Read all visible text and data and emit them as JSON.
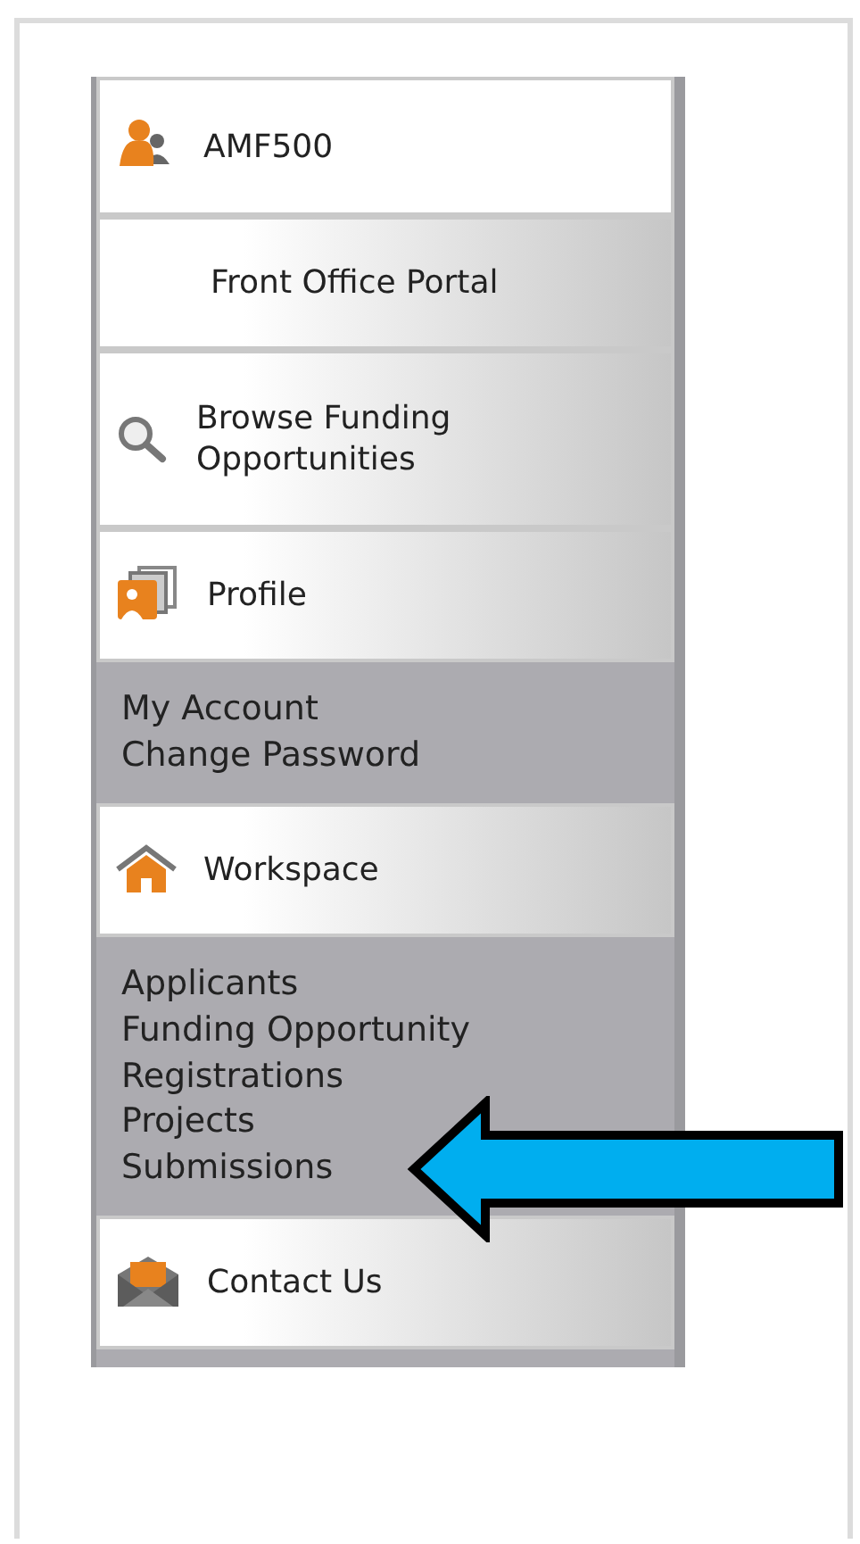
{
  "menu": [
    {
      "kind": "user",
      "label": "AMF500"
    },
    {
      "kind": "plain",
      "label": "Front Office Portal"
    },
    {
      "kind": "search",
      "label": "Browse Funding Opportunities"
    },
    {
      "kind": "profile",
      "label": "Profile",
      "links": [
        "My Account",
        "Change Password"
      ]
    },
    {
      "kind": "home",
      "label": "Workspace",
      "links": [
        "Applicants",
        "Funding Opportunity Registrations",
        "Projects",
        "Submissions"
      ]
    },
    {
      "kind": "mail",
      "label": "Contact Us"
    }
  ]
}
